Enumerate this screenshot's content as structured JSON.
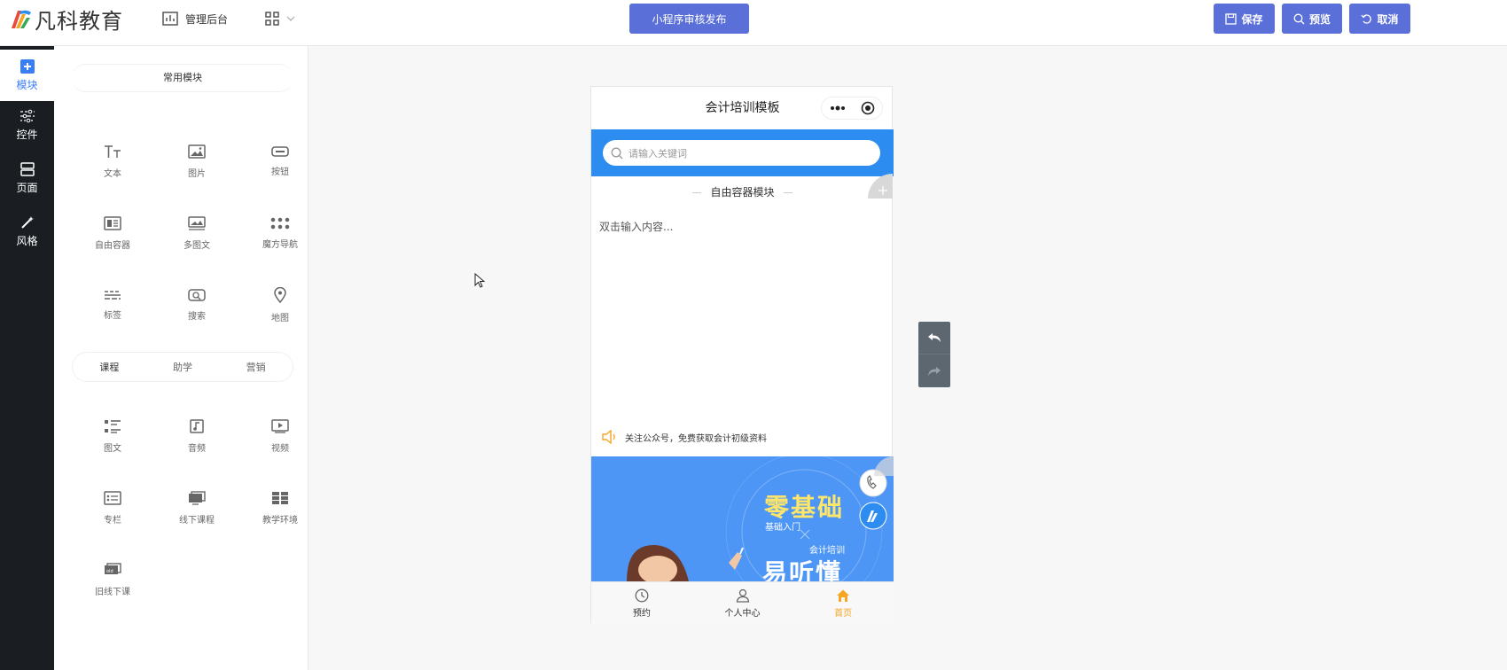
{
  "topbar": {
    "logo_text": "凡科教育",
    "admin_label": "管理后台",
    "publish_label": "小程序审核发布",
    "save_label": "保存",
    "preview_label": "预览",
    "cancel_label": "取消"
  },
  "sidebar": {
    "items": [
      {
        "label": "模块",
        "icon": "plus-square-icon",
        "active": true
      },
      {
        "label": "控件",
        "icon": "sliders-icon",
        "active": false
      },
      {
        "label": "页面",
        "icon": "layout-icon",
        "active": false
      },
      {
        "label": "风格",
        "icon": "magic-wand-icon",
        "active": false
      }
    ]
  },
  "panel": {
    "common_title": "常用模块",
    "common": [
      {
        "label": "文本",
        "icon": "text-icon"
      },
      {
        "label": "图片",
        "icon": "image-icon"
      },
      {
        "label": "按钮",
        "icon": "button-icon"
      },
      {
        "label": "自由容器",
        "icon": "container-icon"
      },
      {
        "label": "多图文",
        "icon": "multi-image-icon"
      },
      {
        "label": "魔方导航",
        "icon": "grid-dots-icon"
      },
      {
        "label": "标签",
        "icon": "tag-icon"
      },
      {
        "label": "搜索",
        "icon": "search-icon"
      },
      {
        "label": "地图",
        "icon": "map-pin-icon"
      }
    ],
    "tabs": [
      "课程",
      "助学",
      "营销"
    ],
    "course": [
      {
        "label": "图文",
        "icon": "list-icon"
      },
      {
        "label": "音频",
        "icon": "music-icon"
      },
      {
        "label": "视频",
        "icon": "video-icon"
      },
      {
        "label": "专栏",
        "icon": "column-icon"
      },
      {
        "label": "线下课程",
        "icon": "offline-course-icon"
      },
      {
        "label": "教学环境",
        "icon": "environment-icon"
      },
      {
        "label": "旧线下课",
        "icon": "old-offline-icon"
      }
    ]
  },
  "phone": {
    "title": "会计培训模板",
    "search_placeholder": "请输入关键词",
    "free_container_title": "自由容器模块",
    "free_container_body": "双击输入内容...",
    "notice": "关注公众号，免费获取会计初级资料",
    "banner": {
      "line1": "零基础",
      "line2": "基础入门",
      "line3": "会计培训",
      "line4": "易听懂"
    },
    "tabbar": [
      {
        "label": "预约",
        "icon": "clock-icon",
        "active": false
      },
      {
        "label": "个人中心",
        "icon": "user-icon",
        "active": false
      },
      {
        "label": "首页",
        "icon": "home-icon",
        "active": true
      }
    ]
  },
  "colors": {
    "primary": "#5b6fd9",
    "sidebar_bg": "#1a1e23",
    "phone_header": "#2d8cf0",
    "active_tab": "#f5a623"
  }
}
